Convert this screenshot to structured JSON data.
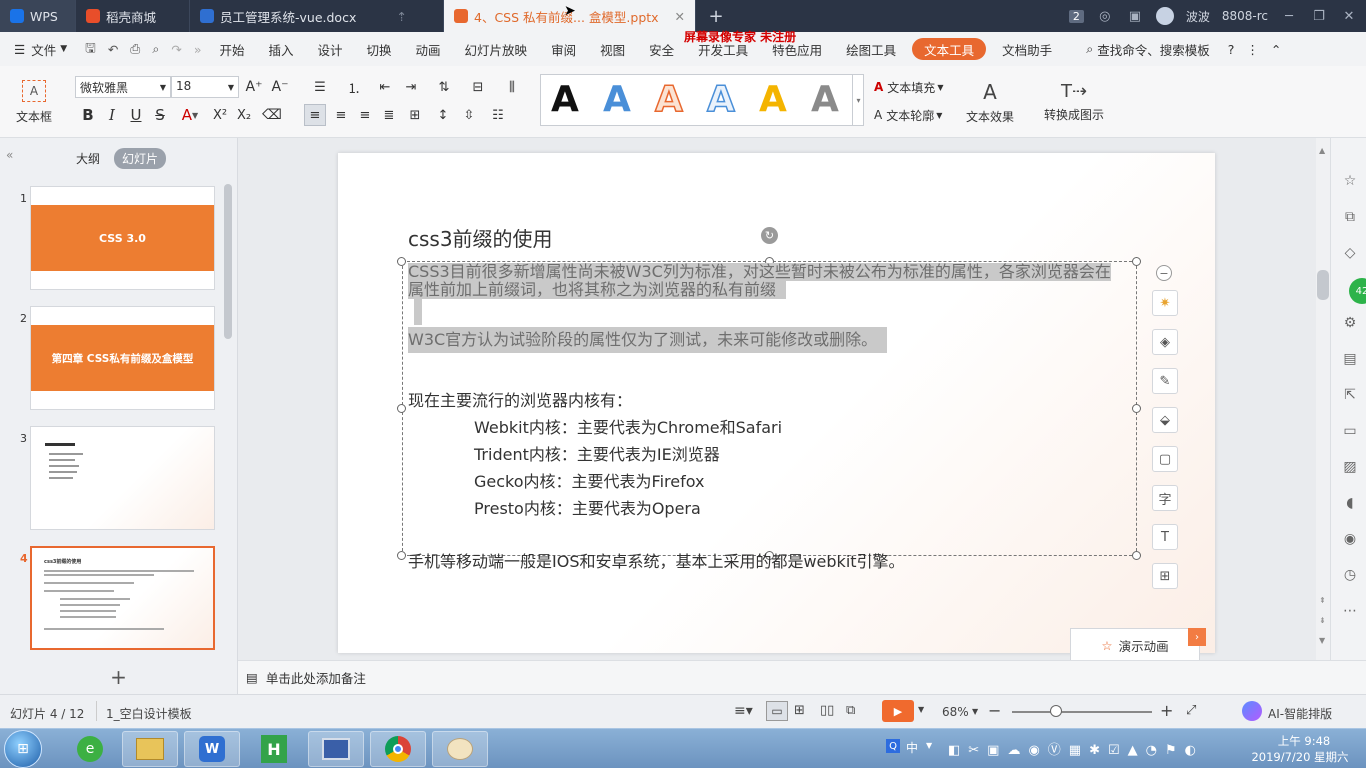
{
  "titlebar": {
    "tabs": [
      {
        "label": "WPS",
        "color": "#1a73e8"
      },
      {
        "label": "稻壳商城",
        "color": "#e84e2a"
      },
      {
        "label": "员工管理系统-vue.docx",
        "color": "#2f6fd1"
      },
      {
        "label": "4、CSS 私有前缀... 盒模型.pptx",
        "color": "#e8682f"
      }
    ],
    "watermark": "屏幕录像专家  未注册",
    "new_tab": "+",
    "badge": "2",
    "user": "波波",
    "user_id": "8808-rc"
  },
  "menubar": {
    "file": "文件",
    "items": [
      "开始",
      "插入",
      "设计",
      "切换",
      "动画",
      "幻灯片放映",
      "审阅",
      "视图",
      "安全",
      "开发工具",
      "特色应用",
      "绘图工具",
      "文本工具",
      "文档助手"
    ],
    "active": "文本工具",
    "search": "查找命令、搜索模板",
    "help": "?"
  },
  "ribbon": {
    "textbox_label": "文本框",
    "font_name": "微软雅黑",
    "font_size": "18",
    "text_fill": "文本填充",
    "text_outline": "文本轮廓",
    "text_effect": "文本效果",
    "convert": "转换成图示",
    "gallery_letters": [
      "A",
      "A",
      "A",
      "A",
      "A",
      "A"
    ]
  },
  "leftpanel": {
    "tab_outline": "大纲",
    "tab_slides": "幻灯片",
    "slides": [
      {
        "num": "1",
        "title": "CSS 3.0"
      },
      {
        "num": "2",
        "title": "第四章  CSS私有前缀及盒模型"
      },
      {
        "num": "3",
        "title": ""
      },
      {
        "num": "4",
        "title": "css3前缀的使用"
      }
    ],
    "add": "+"
  },
  "slide": {
    "title": "css3前缀的使用",
    "para1_line1": "CSS3目前很多新增属性尚未被W3C列为标准，对这些暂时未被公布为标准的属性，各家浏览器会在",
    "para1_line2": "属性前加上前缀词，也将其称之为浏览器的私有前缀",
    "para2": "W3C官方认为试验阶段的属性仅为了测试，未来可能修改或删除。",
    "para3": "现在主要流行的浏览器内核有：",
    "kernels": [
      "Webkit内核：主要代表为Chrome和Safari",
      "Trident内核：主要代表为IE浏览器",
      "Gecko内核：主要代表为Firefox",
      "Presto内核：主要代表为Opera"
    ],
    "para4": "手机等移动端一般是IOS和安卓系统，基本上采用的都是webkit引擎。",
    "animation_btn": "演示动画"
  },
  "notes": {
    "placeholder": "单击此处添加备注"
  },
  "status": {
    "slide_info": "幻灯片 4 / 12",
    "template": "1_空白设计模板",
    "zoom": "68%",
    "ai": "AI-智能排版"
  },
  "taskbar": {
    "ime": "中",
    "time": "上午 9:48",
    "date": "2019/7/20 星期六"
  },
  "colors": {
    "accent": "#e8682f",
    "titlebar": "#2b3445"
  }
}
